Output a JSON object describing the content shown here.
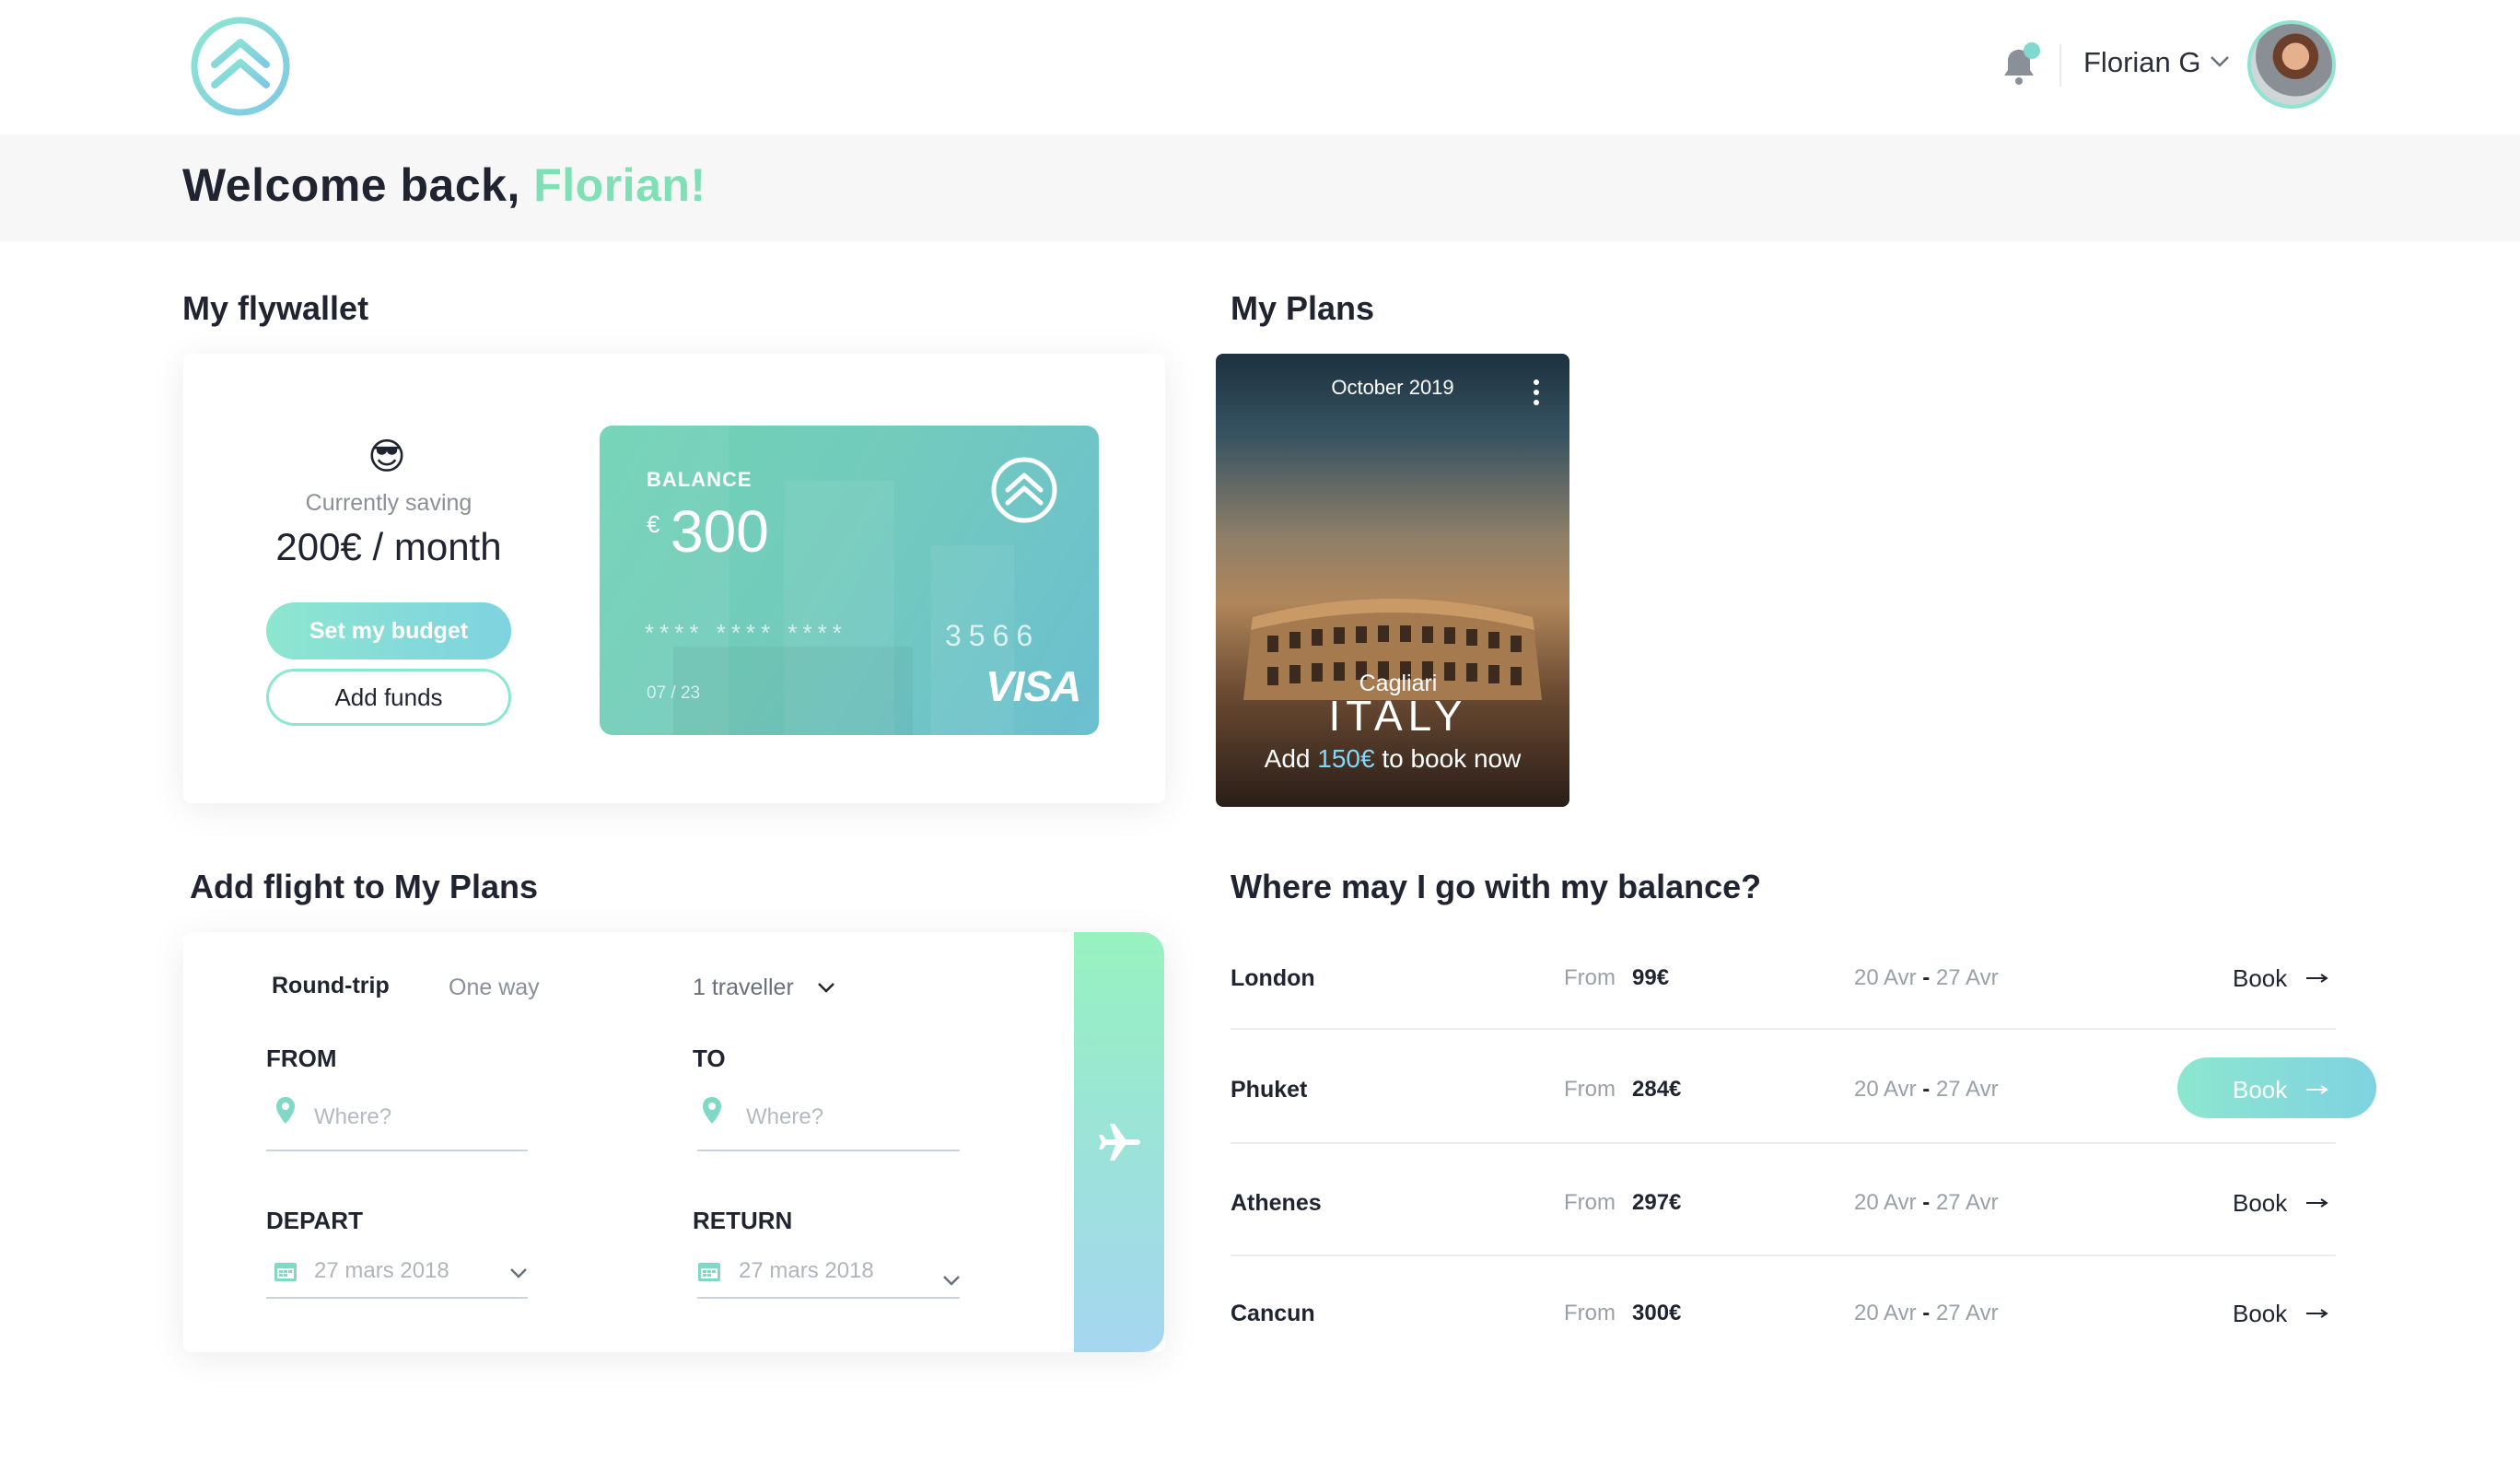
{
  "header": {
    "logo_icon": "chevron-up-double-icon",
    "notification_icon": "bell-icon",
    "user_name": "Florian G",
    "user_menu_icon": "chevron-down-icon",
    "accent_color": "#7fe0b6"
  },
  "welcome": {
    "prefix": "Welcome back, ",
    "name": "Florian!"
  },
  "flywallet": {
    "title": "My flywallet",
    "emoji": "😎",
    "saving_label": "Currently saving",
    "saving_amount": "200€ / month",
    "set_budget_label": "Set my budget",
    "add_funds_label": "Add funds",
    "card": {
      "balance_label": "BALANCE",
      "currency": "€",
      "balance": "300",
      "masked_groups": "**** **** ****",
      "last_digits": "3566",
      "expiry": "07 / 23",
      "brand": "VISA"
    }
  },
  "plans": {
    "title": "My Plans",
    "card": {
      "date": "October 2019",
      "city": "Cagliari",
      "country": "ITALY",
      "cta_prefix": "Add ",
      "cta_amount": "150€",
      "cta_suffix": " to book now"
    }
  },
  "flight_form": {
    "title": "Add flight to My Plans",
    "tab_round": "Round-trip",
    "tab_oneway": "One way",
    "travellers": "1 traveller",
    "from_label": "FROM",
    "from_placeholder": "Where?",
    "to_label": "TO",
    "to_placeholder": "Where?",
    "depart_label": "DEPART",
    "depart_value": "27 mars 2018",
    "return_label": "RETURN",
    "return_value": "27 mars 2018",
    "search_icon": "airplane-icon"
  },
  "destinations": {
    "title": "Where may I go with my balance?",
    "from_label": "From",
    "book_label": "Book",
    "items": [
      {
        "city": "London",
        "price": "99€",
        "date_start": "20 Avr",
        "date_sep": "-",
        "date_end": "27 Avr"
      },
      {
        "city": "Phuket",
        "price": "284€",
        "date_start": "20 Avr",
        "date_sep": "-",
        "date_end": "27 Avr"
      },
      {
        "city": "Athenes",
        "price": "297€",
        "date_start": "20 Avr",
        "date_sep": "-",
        "date_end": "27 Avr"
      },
      {
        "city": "Cancun",
        "price": "300€",
        "date_start": "20 Avr",
        "date_sep": "-",
        "date_end": "27 Avr"
      }
    ]
  }
}
